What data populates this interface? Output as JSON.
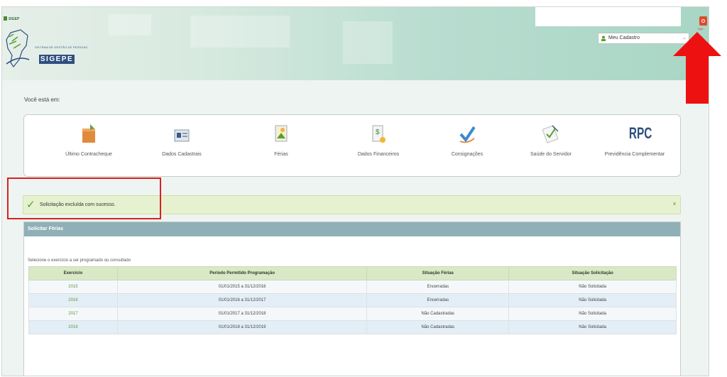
{
  "browser": {
    "tab_text": ""
  },
  "header": {
    "brand": "SIGEP",
    "logo_small": "SISTEMA DE GESTÃO DE PESSOAS",
    "logo_text": "SIGEPE",
    "user_menu": {
      "selected": "Meu Cadastro"
    },
    "logout_label": "Sair"
  },
  "breadcrumb": {
    "label": "Você está em:"
  },
  "menu": {
    "items": [
      {
        "label": "Último Contracheque",
        "icon": "folder-icon"
      },
      {
        "label": "Dados Cadastrais",
        "icon": "id-card-icon"
      },
      {
        "label": "Férias",
        "icon": "vacation-icon"
      },
      {
        "label": "Dados Financeiros",
        "icon": "money-icon"
      },
      {
        "label": "Consignações",
        "icon": "check-arrow-icon"
      },
      {
        "label": "Saúde do Servidor",
        "icon": "stethoscope-icon"
      },
      {
        "label": "Previdência Complementar",
        "icon": "rpc-icon",
        "icon_text": "RPC"
      }
    ]
  },
  "alert": {
    "message": "Solicitação excluída com sucesso.",
    "close": "x"
  },
  "panel": {
    "title": "Solicitar Férias",
    "hint": "Selecione o exercício a ser programado ou consultado",
    "columns": [
      "Exercício",
      "Período Permitido Programação",
      "Situação Férias",
      "Situação Solicitação"
    ],
    "rows": [
      [
        "2015",
        "01/01/2015 a 31/12/2016",
        "Encerradas",
        "Não Solicitada"
      ],
      [
        "2016",
        "01/01/2016 a 31/12/2017",
        "Encerradas",
        "Não Solicitada"
      ],
      [
        "2017",
        "01/01/2017 a 31/12/2018",
        "Não Cadastradas",
        "Não Solicitada"
      ],
      [
        "2018",
        "01/01/2018 a 31/12/2019",
        "Não Cadastradas",
        "Não Solicitada"
      ]
    ]
  },
  "colors": {
    "accent": "#8fb0b6",
    "success_bg": "#e6f1cf",
    "annotation": "#e01010"
  }
}
